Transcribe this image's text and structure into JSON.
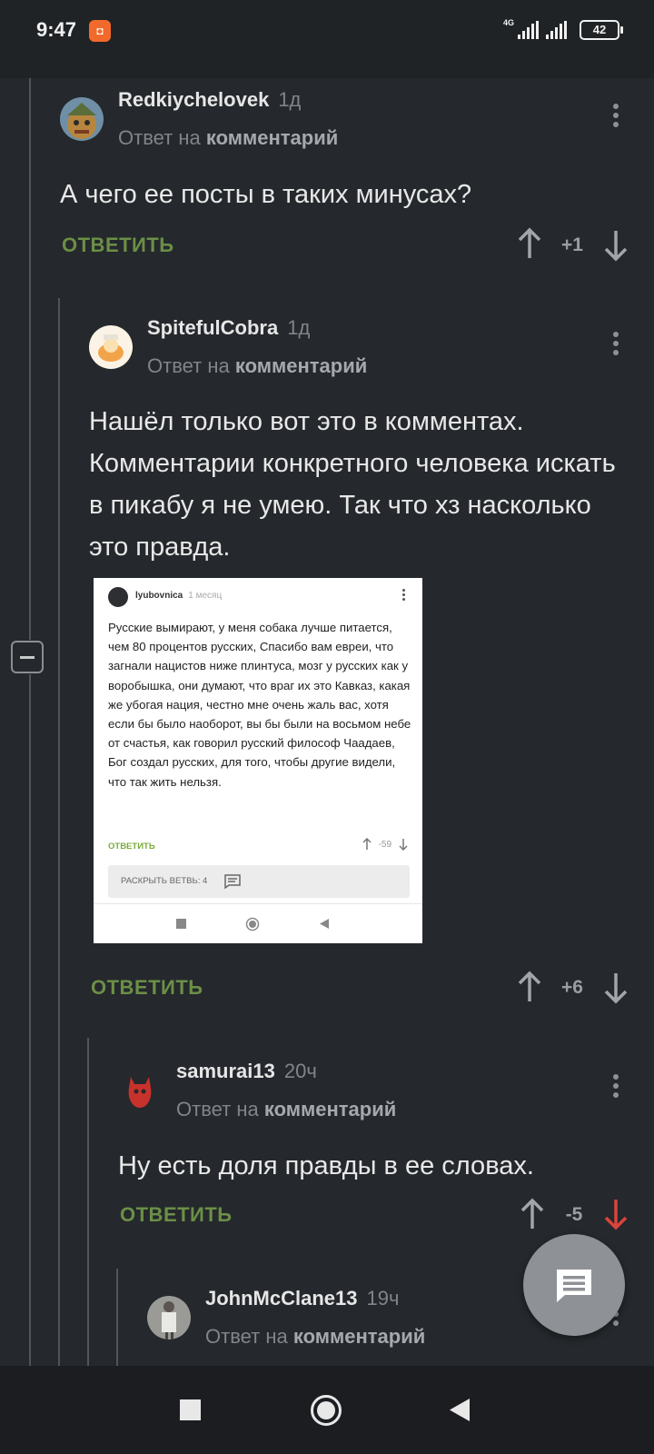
{
  "status_bar": {
    "time": "9:47",
    "network": "4G",
    "battery": "42"
  },
  "comments": [
    {
      "username": "Redkiychelovek",
      "time": "1д",
      "reply_prefix": "Ответ на",
      "reply_target": "комментарий",
      "text": "А чего ее посты в таких минусах?",
      "reply_label": "ОТВЕТИТЬ",
      "score": "+1"
    },
    {
      "username": "SpitefulCobra",
      "time": "1д",
      "reply_prefix": "Ответ на",
      "reply_target": "комментарий",
      "text": "Нашёл только вот это в комментах. Комментарии конкретного человека искать в пикабу я не умею. Так что хз насколько это правда.",
      "reply_label": "ОТВЕТИТЬ",
      "score": "+6"
    },
    {
      "username": "samurai13",
      "time": "20ч",
      "reply_prefix": "Ответ на",
      "reply_target": "комментарий",
      "text": "Ну есть доля правды в ее словах.",
      "reply_label": "ОТВЕТИТЬ",
      "score": "-5"
    },
    {
      "username": "JohnMcClane13",
      "time": "19ч",
      "reply_prefix": "Ответ на",
      "reply_target": "комментарий"
    }
  ],
  "embedded_screenshot": {
    "username": "lyubovnica",
    "time": "1 месяц",
    "text": "Русские вымирают, у меня собака лучше питается, чем 80 процентов русских, Спасибо вам евреи, что загнали нацистов ниже плинтуса, мозг у русских как у воробышка, они думают, что враг их это Кавказ, какая же убогая нация, честно мне очень жаль вас, хотя если бы было наоборот, вы бы были на восьмом небе от счастья, как говорил русский философ Чаадаев, Бог создал русских, для того, чтобы другие видели, что так жить нельзя.",
    "reply_label": "ОТВЕТИТЬ",
    "score": "-59",
    "branch_label": "РАСКРЫТЬ ВЕТВЬ: 4"
  },
  "colors": {
    "background": "#25282c",
    "reply_green": "#6b8f47",
    "downvote_red": "#d9443b",
    "fab": "#8e9196"
  },
  "icons": [
    "app-notification-icon",
    "signal-icon",
    "battery-icon",
    "kebab-menu-icon",
    "arrow-up-icon",
    "arrow-down-icon",
    "collapse-icon",
    "comment-fab-icon",
    "stop-icon",
    "home-icon",
    "back-icon"
  ]
}
